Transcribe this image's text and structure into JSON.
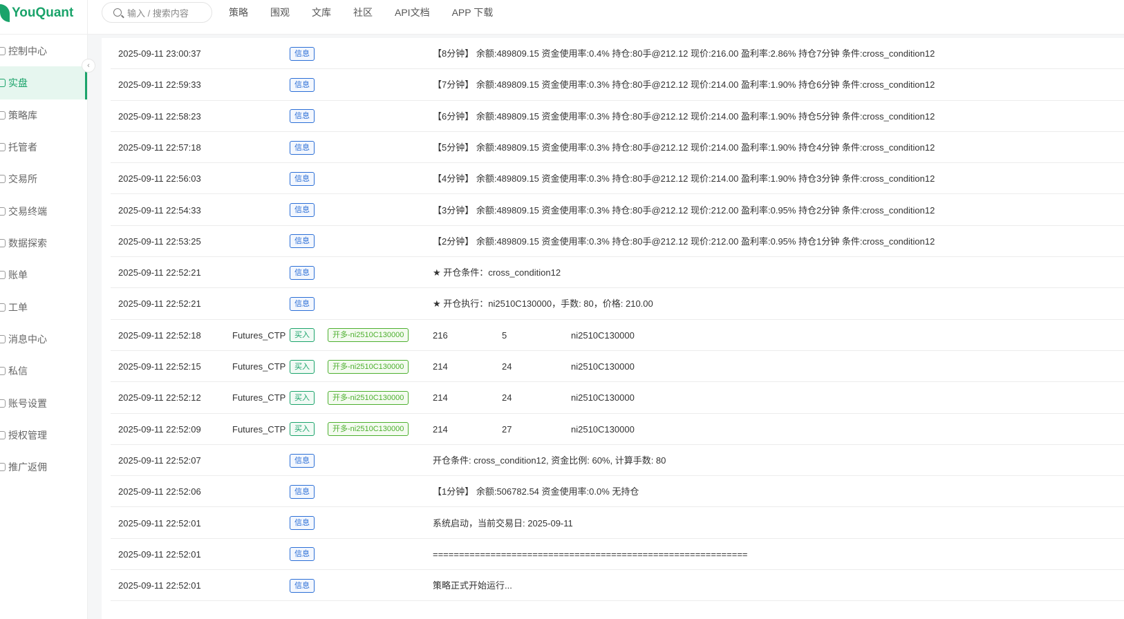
{
  "header": {
    "logo_text": "YouQuant",
    "search_placeholder": "输入 / 搜索内容",
    "nav": [
      "策略",
      "围观",
      "文库",
      "社区",
      "API文档",
      "APP 下载"
    ]
  },
  "sidebar": {
    "items": [
      {
        "label": "控制中心",
        "icon": "dashboard-icon"
      },
      {
        "label": "实盘",
        "icon": "live-trading-icon",
        "active": true
      },
      {
        "label": "策略库",
        "icon": "strategy-icon"
      },
      {
        "label": "托管者",
        "icon": "docker-icon"
      },
      {
        "label": "交易所",
        "icon": "exchange-icon"
      },
      {
        "label": "交易终端",
        "icon": "terminal-icon"
      },
      {
        "label": "数据探索",
        "icon": "data-icon"
      },
      {
        "label": "账单",
        "icon": "bill-icon"
      },
      {
        "label": "工单",
        "icon": "ticket-icon"
      },
      {
        "label": "消息中心",
        "icon": "bell-icon"
      },
      {
        "label": "私信",
        "icon": "message-icon"
      },
      {
        "label": "账号设置",
        "icon": "settings-icon"
      },
      {
        "label": "授权管理",
        "icon": "auth-icon"
      },
      {
        "label": "推广返佣",
        "icon": "promo-icon"
      }
    ]
  },
  "log": {
    "rows": [
      {
        "time": "2025-09-11 23:00:37",
        "type": "信息",
        "msg": "【8分钟】 余额:489809.15 资金使用率:0.4% 持仓:80手@212.12 现价:216.00 盈利率:2.86% 持仓7分钟 条件:cross_condition12"
      },
      {
        "time": "2025-09-11 22:59:33",
        "type": "信息",
        "msg": "【7分钟】 余额:489809.15 资金使用率:0.3% 持仓:80手@212.12 现价:214.00 盈利率:1.90% 持仓6分钟 条件:cross_condition12"
      },
      {
        "time": "2025-09-11 22:58:23",
        "type": "信息",
        "msg": "【6分钟】 余额:489809.15 资金使用率:0.3% 持仓:80手@212.12 现价:214.00 盈利率:1.90% 持仓5分钟 条件:cross_condition12"
      },
      {
        "time": "2025-09-11 22:57:18",
        "type": "信息",
        "msg": "【5分钟】 余额:489809.15 资金使用率:0.3% 持仓:80手@212.12 现价:214.00 盈利率:1.90% 持仓4分钟 条件:cross_condition12"
      },
      {
        "time": "2025-09-11 22:56:03",
        "type": "信息",
        "msg": "【4分钟】 余额:489809.15 资金使用率:0.3% 持仓:80手@212.12 现价:214.00 盈利率:1.90% 持仓3分钟 条件:cross_condition12"
      },
      {
        "time": "2025-09-11 22:54:33",
        "type": "信息",
        "msg": "【3分钟】 余额:489809.15 资金使用率:0.3% 持仓:80手@212.12 现价:212.00 盈利率:0.95% 持仓2分钟 条件:cross_condition12"
      },
      {
        "time": "2025-09-11 22:53:25",
        "type": "信息",
        "msg": "【2分钟】 余额:489809.15 资金使用率:0.3% 持仓:80手@212.12 现价:212.00 盈利率:0.95% 持仓1分钟 条件:cross_condition12"
      },
      {
        "time": "2025-09-11 22:52:21",
        "type": "信息",
        "msg": "★ 开仓条件：cross_condition12"
      },
      {
        "time": "2025-09-11 22:52:21",
        "type": "信息",
        "msg": "★ 开仓执行：ni2510C130000，手数: 80，价格: 210.00"
      },
      {
        "time": "2025-09-11 22:52:18",
        "exchange": "Futures_CTP",
        "type": "买入",
        "action": "开多-ni2510C130000",
        "price": "216",
        "qty": "5",
        "code": "ni2510C130000"
      },
      {
        "time": "2025-09-11 22:52:15",
        "exchange": "Futures_CTP",
        "type": "买入",
        "action": "开多-ni2510C130000",
        "price": "214",
        "qty": "24",
        "code": "ni2510C130000"
      },
      {
        "time": "2025-09-11 22:52:12",
        "exchange": "Futures_CTP",
        "type": "买入",
        "action": "开多-ni2510C130000",
        "price": "214",
        "qty": "24",
        "code": "ni2510C130000"
      },
      {
        "time": "2025-09-11 22:52:09",
        "exchange": "Futures_CTP",
        "type": "买入",
        "action": "开多-ni2510C130000",
        "price": "214",
        "qty": "27",
        "code": "ni2510C130000"
      },
      {
        "time": "2025-09-11 22:52:07",
        "type": "信息",
        "msg": "开仓条件: cross_condition12, 资金比例: 60%, 计算手数: 80"
      },
      {
        "time": "2025-09-11 22:52:06",
        "type": "信息",
        "msg": "【1分钟】 余额:506782.54 资金使用率:0.0% 无持仓"
      },
      {
        "time": "2025-09-11 22:52:01",
        "type": "信息",
        "msg": "系统启动，当前交易日: 2025-09-11"
      },
      {
        "time": "2025-09-11 22:52:01",
        "type": "信息",
        "msg": "============================================================"
      },
      {
        "time": "2025-09-11 22:52:01",
        "type": "信息",
        "msg": "策略正式开始运行..."
      }
    ]
  }
}
